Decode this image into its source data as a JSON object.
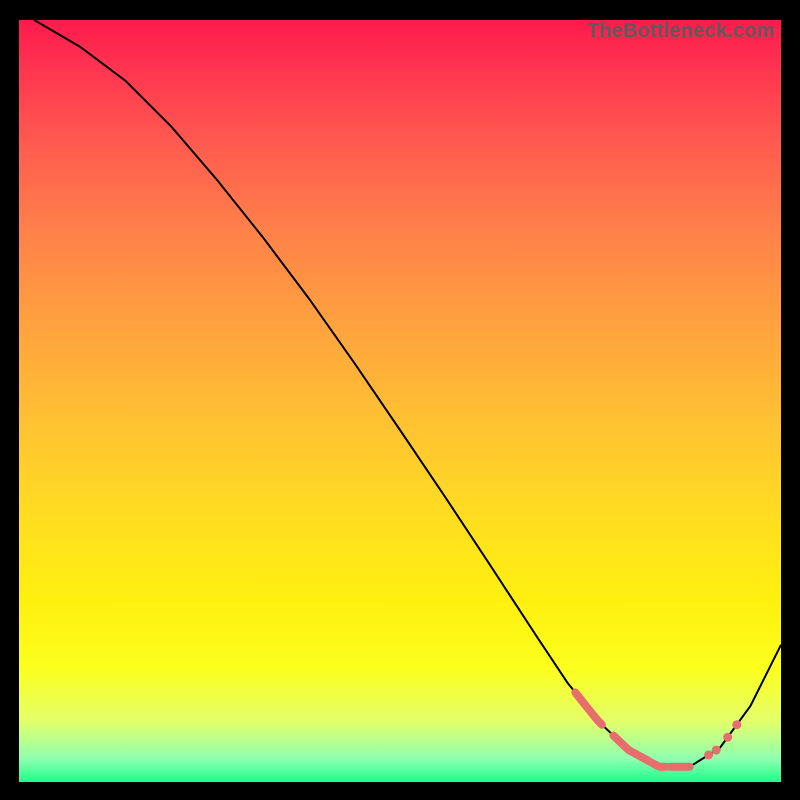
{
  "watermark": "TheBottleneck.com",
  "chart_data": {
    "type": "line",
    "title": "",
    "xlabel": "",
    "ylabel": "",
    "xlim": [
      0,
      100
    ],
    "ylim": [
      0,
      100
    ],
    "grid": false,
    "series": [
      {
        "name": "curve",
        "x": [
          2,
          8,
          14,
          20,
          26,
          32,
          38,
          44,
          50,
          56,
          62,
          68,
          72,
          76,
          80,
          84,
          88,
          92,
          96,
          100
        ],
        "y": [
          100,
          96.5,
          92,
          86,
          79,
          71.5,
          63.5,
          55,
          46.2,
          37.3,
          28.2,
          19,
          13,
          8,
          4.2,
          2,
          2,
          4.5,
          10,
          18
        ]
      }
    ],
    "highlight": {
      "segments_x": [
        [
          73,
          76.5
        ],
        [
          78,
          80.5
        ],
        [
          80.8,
          82.8
        ],
        [
          83.2,
          85
        ],
        [
          85.5,
          88
        ]
      ],
      "dots_x": [
        90.5,
        91.5,
        93,
        94.2
      ]
    },
    "colors": {
      "curve": "#000000",
      "highlight": "#e86d6d",
      "gradient_top": "#ff1a4d",
      "gradient_bottom": "#1cff8a"
    }
  }
}
